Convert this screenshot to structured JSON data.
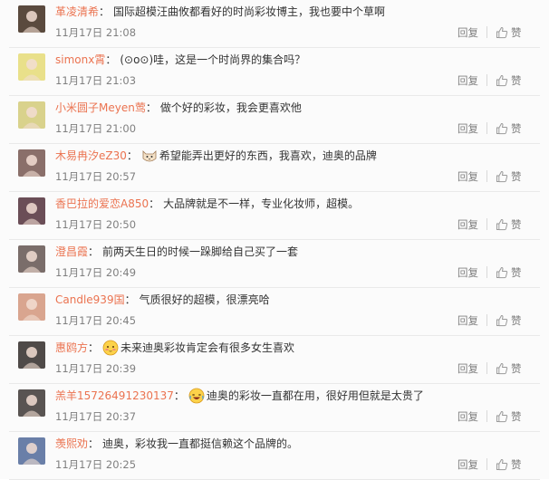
{
  "comments": [
    {
      "username": "革凌清希",
      "colon": "：",
      "emoji": "",
      "text": "国际超模汪曲攸都看好的时尚彩妆博主，我也要中个草啊",
      "time": "11月17日 21:08",
      "avatar_color": "#5a4a3e"
    },
    {
      "username": "simonx霄",
      "colon": "：",
      "emoji": "",
      "text": "(⊙o⊙)哇，这是一个时尚界的集合吗？",
      "time": "11月17日 21:03",
      "avatar_color": "#e9e08a"
    },
    {
      "username": "小米圆子Meyen莺",
      "colon": "：",
      "emoji": "",
      "text": "做个好的彩妆，我会更喜欢他",
      "time": "11月17日 21:00",
      "avatar_color": "#d9d28c"
    },
    {
      "username": "木易冉汐eZ30",
      "colon": "：",
      "emoji": "cat-face-emoji",
      "text": "希望能弄出更好的东西，我喜欢，迪奥的品牌",
      "time": "11月17日 20:57",
      "avatar_color": "#8a6f6a"
    },
    {
      "username": "香巴拉的爱恋A850",
      "colon": "：",
      "emoji": "",
      "text": "大品牌就是不一样，专业化妆师，超模。",
      "time": "11月17日 20:50",
      "avatar_color": "#6b4e57"
    },
    {
      "username": "澄昌霞",
      "colon": "：",
      "emoji": "",
      "text": "前两天生日的时候一跺脚给自己买了一套",
      "time": "11月17日 20:49",
      "avatar_color": "#7a6d6a"
    },
    {
      "username": "Candle939国",
      "colon": "：",
      "emoji": "",
      "text": "气质很好的超模，很漂亮哈",
      "time": "11月17日 20:45",
      "avatar_color": "#d9a58f"
    },
    {
      "username": "惠鸥方",
      "colon": "：",
      "emoji": "shy-face-emoji",
      "text": "未来迪奥彩妆肯定会有很多女生喜欢",
      "time": "11月17日 20:39",
      "avatar_color": "#4f4a48"
    },
    {
      "username": "羔羊15726491230137",
      "colon": "：",
      "emoji": "laughing-face-emoji",
      "text": "迪奥的彩妆一直都在用，很好用但就是太贵了",
      "time": "11月17日 20:37",
      "avatar_color": "#595452"
    },
    {
      "username": "羡熙劝",
      "colon": "：",
      "emoji": "",
      "text": "迪奥，彩妆我一直都挺信赖这个品牌的。",
      "time": "11月17日 20:25",
      "avatar_color": "#6a7fa8"
    }
  ],
  "actions": {
    "reply_label": "回复",
    "like_label": "赞"
  },
  "colors": {
    "username": "#eb7350",
    "meta": "#808080",
    "text": "#333333"
  }
}
